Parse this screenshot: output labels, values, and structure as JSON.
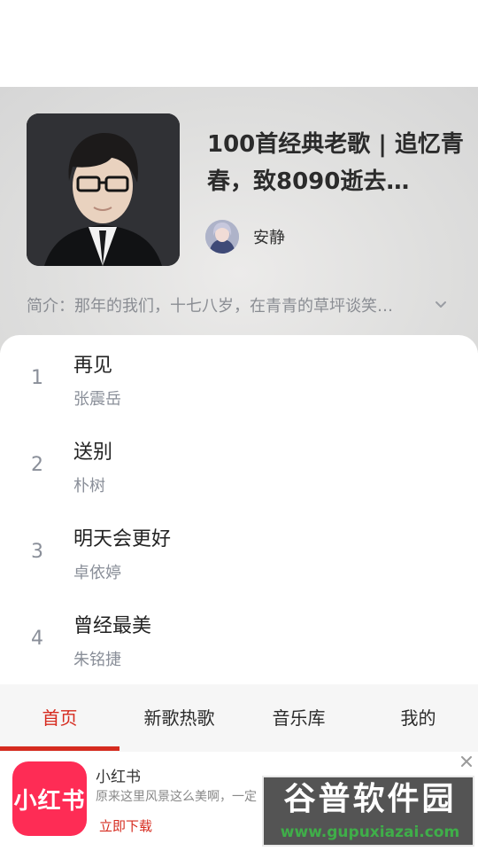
{
  "playlist": {
    "title": "100首经典老歌 | 追忆青春，致8090逝去…",
    "creator": "安静",
    "intro": "简介：那年的我们，十七八岁，在青青的草坪谈笑…"
  },
  "songs": [
    {
      "index": "1",
      "title": "再见",
      "artist": "张震岳"
    },
    {
      "index": "2",
      "title": "送别",
      "artist": "朴树"
    },
    {
      "index": "3",
      "title": "明天会更好",
      "artist": "卓依婷"
    },
    {
      "index": "4",
      "title": "曾经最美",
      "artist": "朱铭捷"
    }
  ],
  "tabs": [
    {
      "label": "首页",
      "active": true
    },
    {
      "label": "新歌热歌",
      "active": false
    },
    {
      "label": "音乐库",
      "active": false
    },
    {
      "label": "我的",
      "active": false
    }
  ],
  "ad": {
    "logo_text": "小红书",
    "name": "小红书",
    "description": "原来这里风景这么美啊，一定",
    "cta": "立即下载"
  },
  "watermark": {
    "main": "谷普软件园",
    "url": "www.gupuxiazai.com"
  },
  "colors": {
    "accent": "#d62b1f",
    "ad_brand": "#fe2c55"
  }
}
